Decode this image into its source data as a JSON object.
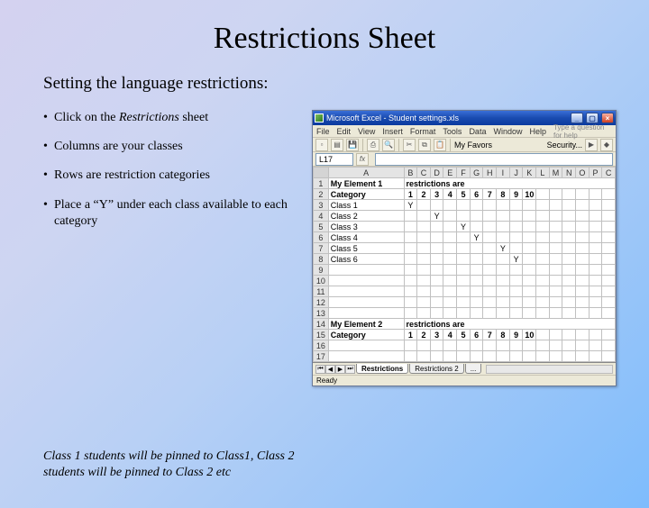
{
  "title": "Restrictions Sheet",
  "subtitle": "Setting the language restrictions:",
  "bullets": [
    {
      "pre": "Click on the ",
      "em": "Restrictions",
      "post": " sheet"
    },
    {
      "text": "Columns are your classes"
    },
    {
      "text": "Rows are restriction categories"
    },
    {
      "text": "Place a “Y” under each class available to each category"
    }
  ],
  "footnote": "Class 1 students will be pinned to Class1, Class 2 students will be pinned to Class 2 etc",
  "spreadsheet": {
    "window_title": "Microsoft Excel - Student settings.xls",
    "menus": [
      "File",
      "Edit",
      "View",
      "Insert",
      "Format",
      "Tools",
      "Data",
      "Window",
      "Help"
    ],
    "help_hint": "Type a question for help",
    "namebox": "L17",
    "tool_labels": {
      "my_favors": "My Favors",
      "security": "Security..."
    },
    "columns": [
      "A",
      "B",
      "C",
      "D",
      "E",
      "F",
      "G",
      "H",
      "I",
      "J",
      "K",
      "L",
      "M",
      "N",
      "O",
      "P",
      "C"
    ],
    "rows": [
      {
        "n": "1",
        "a": "My Element 1",
        "a_class": "bold",
        "note": "restrictions are",
        "span": true
      },
      {
        "n": "2",
        "a": "Category",
        "a_class": "bold",
        "nums": [
          "1",
          "2",
          "3",
          "4",
          "5",
          "6",
          "7",
          "8",
          "9",
          "10"
        ]
      },
      {
        "n": "3",
        "a": "Class 1",
        "marks": {
          "0": "Y"
        }
      },
      {
        "n": "4",
        "a": "Class 2",
        "marks": {
          "2": "Y"
        }
      },
      {
        "n": "5",
        "a": "Class 3",
        "marks": {
          "4": "Y"
        }
      },
      {
        "n": "6",
        "a": "Class 4",
        "marks": {
          "5": "Y"
        }
      },
      {
        "n": "7",
        "a": "Class 5",
        "marks": {
          "7": "Y"
        }
      },
      {
        "n": "8",
        "a": "Class 6",
        "marks": {
          "8": "Y"
        }
      },
      {
        "n": "9",
        "a": ""
      },
      {
        "n": "10",
        "a": ""
      },
      {
        "n": "11",
        "a": ""
      },
      {
        "n": "12",
        "a": ""
      },
      {
        "n": "13",
        "a": ""
      },
      {
        "n": "14",
        "a": "My Element 2",
        "a_class": "bold",
        "note": "restrictions are",
        "span": true
      },
      {
        "n": "15",
        "a": "Category",
        "a_class": "bold",
        "nums": [
          "1",
          "2",
          "3",
          "4",
          "5",
          "6",
          "7",
          "8",
          "9",
          "10"
        ]
      },
      {
        "n": "16",
        "a": ""
      },
      {
        "n": "17",
        "a": ""
      }
    ],
    "tabs": [
      "Restrictions",
      "Restrictions 2",
      "..."
    ],
    "active_tab": 0,
    "status": "Ready",
    "win_btns": {
      "min": "_",
      "max": "▢",
      "close": "×"
    },
    "nav_btns": [
      "⏮",
      "◀",
      "▶",
      "⏭"
    ]
  }
}
